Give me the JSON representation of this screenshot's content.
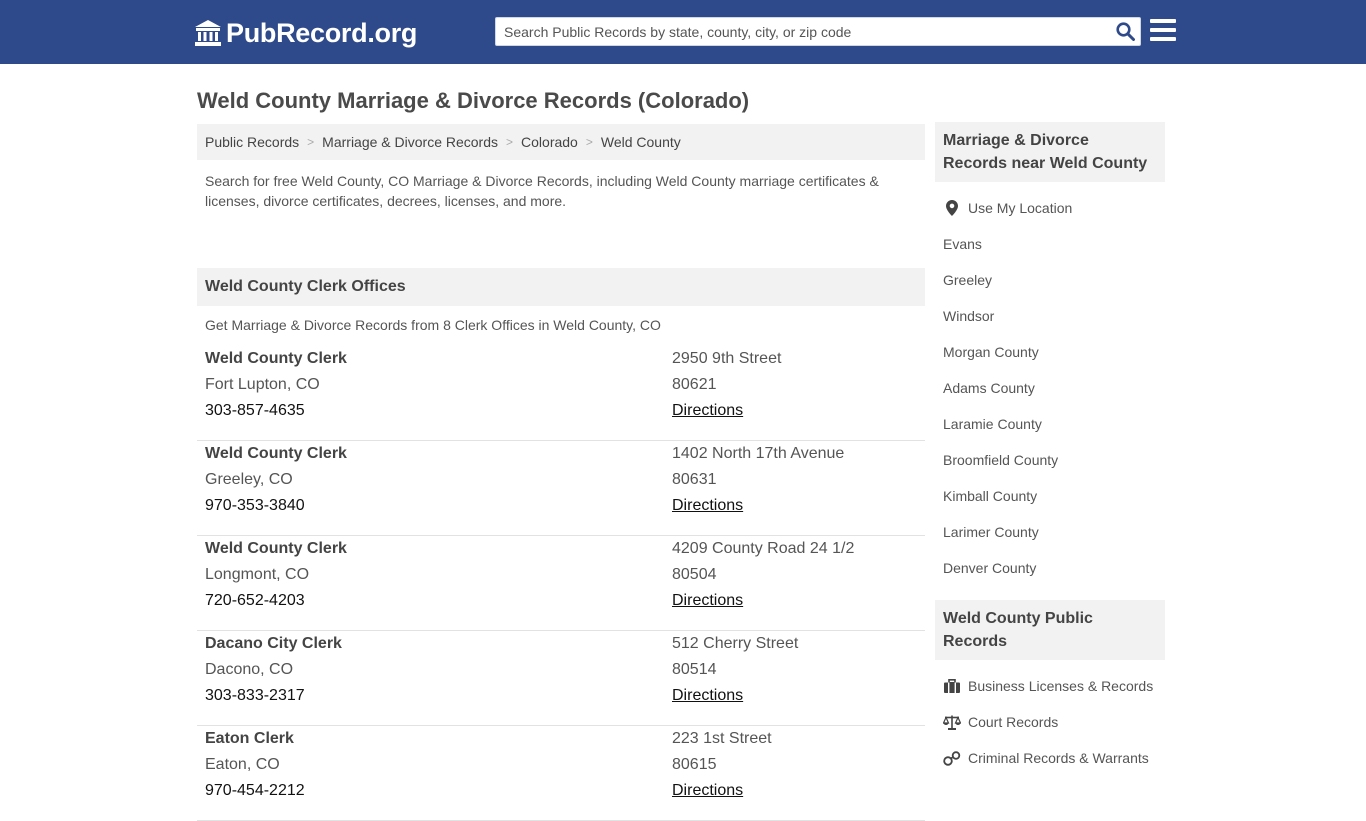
{
  "header": {
    "logo_text": "PubRecord.org",
    "search_placeholder": "Search Public Records by state, county, city, or zip code"
  },
  "page_title": "Weld County Marriage & Divorce Records (Colorado)",
  "breadcrumb": [
    "Public Records",
    "Marriage & Divorce Records",
    "Colorado",
    "Weld County"
  ],
  "intro": "Search for free Weld County, CO Marriage & Divorce Records, including Weld County marriage certificates & licenses, divorce certificates, decrees, licenses, and more.",
  "offices_section": {
    "title": "Weld County Clerk Offices",
    "subtitle": "Get Marriage & Divorce Records from 8 Clerk Offices in Weld County, CO",
    "directions_label": "Directions",
    "items": [
      {
        "name": "Weld County Clerk",
        "city": "Fort Lupton, CO",
        "phone": "303-857-4635",
        "street": "2950 9th Street",
        "zip": "80621"
      },
      {
        "name": "Weld County Clerk",
        "city": "Greeley, CO",
        "phone": "970-353-3840",
        "street": "1402 North 17th Avenue",
        "zip": "80631"
      },
      {
        "name": "Weld County Clerk",
        "city": "Longmont, CO",
        "phone": "720-652-4203",
        "street": "4209 County Road 24 1/2",
        "zip": "80504"
      },
      {
        "name": "Dacano City Clerk",
        "city": "Dacono, CO",
        "phone": "303-833-2317",
        "street": "512 Cherry Street",
        "zip": "80514"
      },
      {
        "name": "Eaton Clerk",
        "city": "Eaton, CO",
        "phone": "970-454-2212",
        "street": "223 1st Street",
        "zip": "80615"
      }
    ]
  },
  "sidebar": {
    "nearby_title": "Marriage & Divorce Records near Weld County",
    "use_location": "Use My Location",
    "nearby": [
      "Evans",
      "Greeley",
      "Windsor",
      "Morgan County",
      "Adams County",
      "Laramie County",
      "Broomfield County",
      "Kimball County",
      "Larimer County",
      "Denver County"
    ],
    "public_title": "Weld County Public Records",
    "public": [
      {
        "label": "Business Licenses & Records",
        "icon": "briefcase-icon"
      },
      {
        "label": "Court Records",
        "icon": "scales-icon"
      },
      {
        "label": "Criminal Records & Warrants",
        "icon": "handcuffs-icon"
      }
    ]
  },
  "colors": {
    "header_bg": "#2f4a8a",
    "panel_bg": "#f2f2f2",
    "search_icon": "#2f4a8a"
  }
}
